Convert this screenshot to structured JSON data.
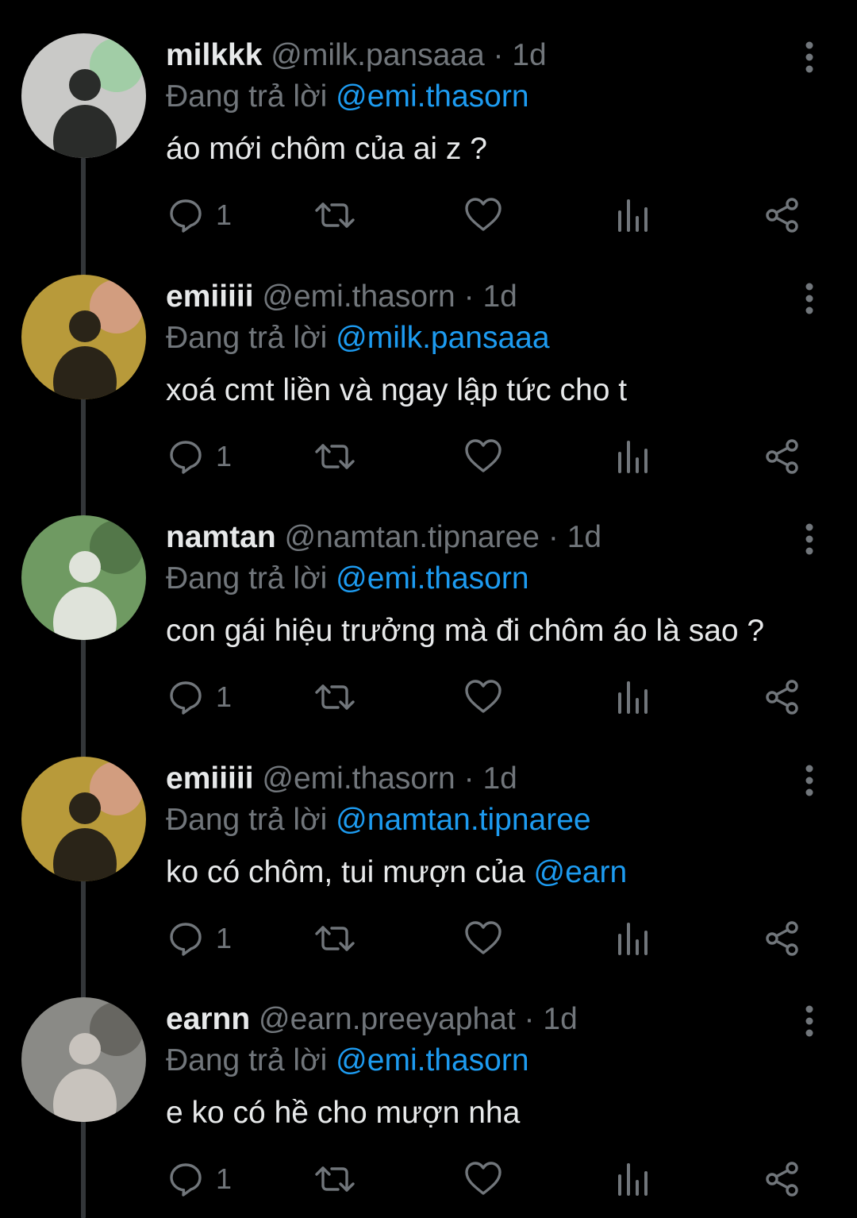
{
  "thread": {
    "tweets": [
      {
        "display_name": "milkkk",
        "handle": "@milk.pansaaa",
        "separator": "·",
        "time": "1d",
        "reply_prefix": "Đang trả lời",
        "reply_to": "@emi.thasorn",
        "text": "áo mới chôm của ai z ?",
        "text_mention": "",
        "reply_count": "1",
        "avatar_colors": [
          "#c9c9c7",
          "#2a2c2a",
          "#7fd08a"
        ]
      },
      {
        "display_name": "emiiiii",
        "handle": "@emi.thasorn",
        "separator": "·",
        "time": "1d",
        "reply_prefix": "Đang trả lời",
        "reply_to": "@milk.pansaaa",
        "text": "xoá cmt liền và ngay lập tức cho t",
        "text_mention": "",
        "reply_count": "1",
        "avatar_colors": [
          "#b89a3a",
          "#2a2418",
          "#e8a0b8"
        ]
      },
      {
        "display_name": "namtan",
        "handle": "@namtan.tipnaree",
        "separator": "·",
        "time": "1d",
        "reply_prefix": "Đang trả lời",
        "reply_to": "@emi.thasorn",
        "text": "con gái hiệu trưởng mà đi chôm áo là sao ?",
        "text_mention": "",
        "reply_count": "1",
        "avatar_colors": [
          "#6f9a62",
          "#dfe3da",
          "#3c5b35"
        ]
      },
      {
        "display_name": "emiiiii",
        "handle": "@emi.thasorn",
        "separator": "·",
        "time": "1d",
        "reply_prefix": "Đang trả lời",
        "reply_to": "@namtan.tipnaree",
        "text": "ko có chôm, tui mượn của ",
        "text_mention": "@earn",
        "reply_count": "1",
        "avatar_colors": [
          "#b89a3a",
          "#2a2418",
          "#e8a0b8"
        ]
      },
      {
        "display_name": "earnn",
        "handle": "@earn.preeyaphat",
        "separator": "·",
        "time": "1d",
        "reply_prefix": "Đang trả lời",
        "reply_to": "@emi.thasorn",
        "text": "e ko có hề cho mượn nha",
        "text_mention": "",
        "reply_count": "1",
        "avatar_colors": [
          "#8a8a86",
          "#c8c3bd",
          "#4a4844"
        ]
      }
    ]
  },
  "icons": {
    "reply": "reply-icon",
    "retweet": "retweet-icon",
    "like": "heart-icon",
    "views": "views-icon",
    "share": "share-icon",
    "more": "more-vertical-icon"
  },
  "colors": {
    "background": "#000000",
    "primary_text": "#e7e9ea",
    "secondary_text": "#71767b",
    "mention": "#1d9bf0",
    "thread_line": "#333639"
  }
}
